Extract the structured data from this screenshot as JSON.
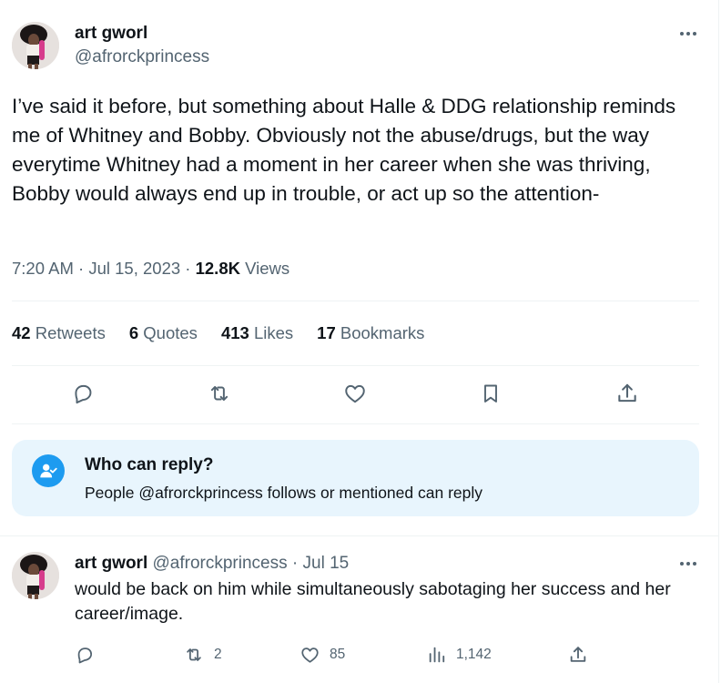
{
  "tweet": {
    "author": {
      "name": "art gworl",
      "handle": "@afrorckprincess"
    },
    "text": "I’ve said it before, but something about Halle & DDG relationship reminds me of Whitney and Bobby. Obviously not the abuse/drugs, but the way everytime Whitney had a moment in her career when she was thriving, Bobby would always end up in trouble, or act up so the attention-",
    "time": "7:20 AM",
    "date": "Jul 15, 2023",
    "views_count": "12.8K",
    "views_label": "Views",
    "separator": "·",
    "stats": {
      "retweets_count": "42",
      "retweets_label": "Retweets",
      "quotes_count": "6",
      "quotes_label": "Quotes",
      "likes_count": "413",
      "likes_label": "Likes",
      "bookmarks_count": "17",
      "bookmarks_label": "Bookmarks"
    },
    "actions": [
      "reply-icon",
      "retweet-icon",
      "like-icon",
      "bookmark-icon",
      "share-icon"
    ]
  },
  "reply_restriction": {
    "title": "Who can reply?",
    "subtitle": "People @afrorckprincess follows or mentioned can reply",
    "icon": "person-check-icon"
  },
  "reply": {
    "author": {
      "name": "art gworl",
      "handle": "@afrorckprincess"
    },
    "date": "Jul 15",
    "separator": "·",
    "text": "would be back on him while simultaneously sabotaging her success and her career/image.",
    "counts": {
      "retweets": "2",
      "likes": "85",
      "views": "1,142"
    }
  },
  "colors": {
    "text": "#0f1419",
    "secondary": "#536471",
    "accent": "#1d9bf0",
    "reply_box_bg": "#e8f5fd",
    "divider": "#eff3f4"
  }
}
